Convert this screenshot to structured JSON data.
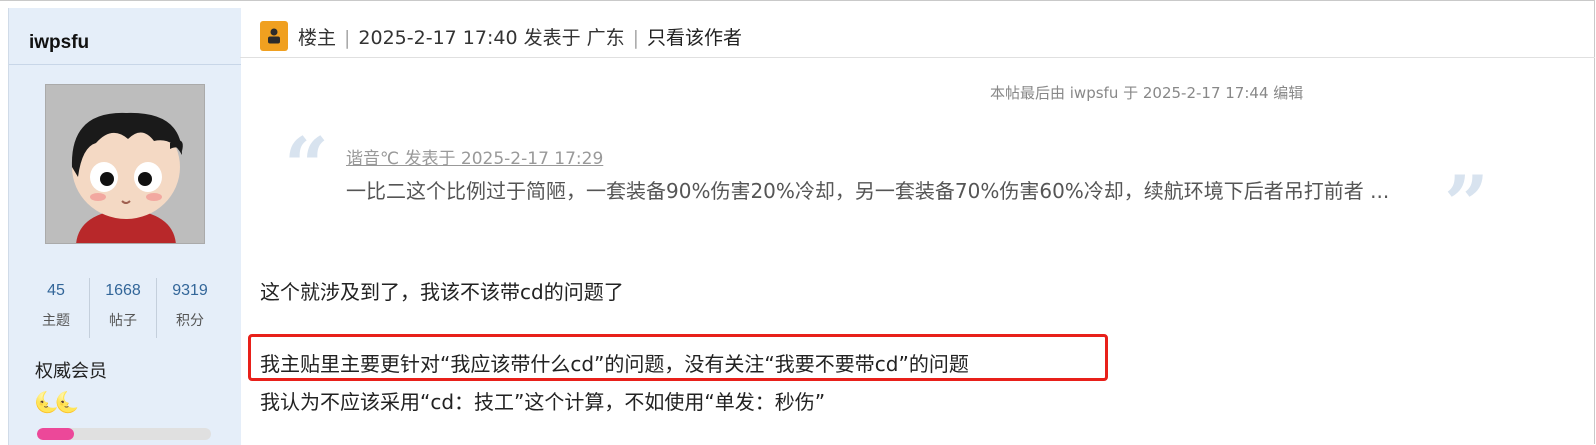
{
  "user": {
    "username": "iwpsfu",
    "avatar_icon": "cartoon-boy-avatar",
    "stats": [
      {
        "value": "45",
        "label": "主题"
      },
      {
        "value": "1668",
        "label": "帖子"
      },
      {
        "value": "9319",
        "label": "积分"
      }
    ],
    "rank": "权威会员",
    "rank_icons": "🌜🌜",
    "level_progress_percent": 21
  },
  "post_header": {
    "op_icon": "thread-starter-icon",
    "op_label": "楼主",
    "sep": "|",
    "posted_at": "2025-2-17 17:40 发表于 广东",
    "author_only": "只看该作者"
  },
  "post": {
    "edit_note": "本帖最后由 iwpsfu 于 2025-2-17 17:44 编辑",
    "quote": {
      "meta": "谐音℃ 发表于 2025-2-17 17:29",
      "text": "一比二这个比例过于简陋，一套装备90%伤害20%冷却，另一套装备70%伤害60%冷却，续航环境下后者吊打前者 ..."
    },
    "lines": [
      "这个就涉及到了，我该不该带cd的问题了",
      "我主贴里主要更针对“我应该带什么cd”的问题，没有关注“我要不要带cd”的问题",
      "我认为不应该采用“cd：技工”这个计算，不如使用“单发：秒伤”"
    ]
  },
  "colors": {
    "sidebar_bg": "#e5eef9",
    "highlight_border": "#e8201a",
    "level_fill": "#ec4899",
    "stat_number": "#336699"
  }
}
